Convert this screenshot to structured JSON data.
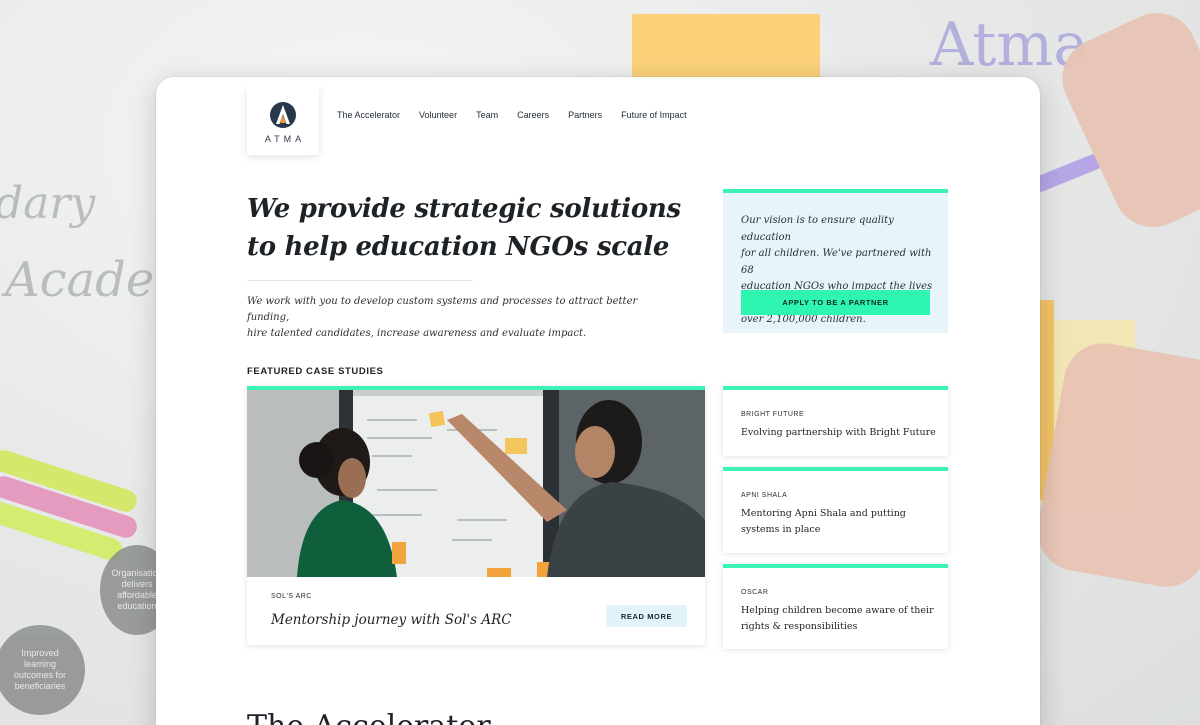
{
  "brand": {
    "name": "ATMA"
  },
  "nav": {
    "items": [
      "The Accelerator",
      "Volunteer",
      "Team",
      "Careers",
      "Partners",
      "Future of Impact"
    ]
  },
  "hero": {
    "title_line1": "We provide strategic solutions",
    "title_line2": "to help education NGOs scale",
    "subtitle_line1": "We work with you to develop custom systems and processes to attract better funding,",
    "subtitle_line2": "hire talented candidates, increase awareness and evaluate impact."
  },
  "vision": {
    "line1": "Our vision is to ensure quality education",
    "line2": "for all children. We've partnered with 68",
    "line3": "education NGOs who impact the lives of",
    "line4": "over 2,100,000 children.",
    "button_label": "APPLY TO BE A PARTNER"
  },
  "case_studies": {
    "section_label": "FEATURED CASE STUDIES",
    "featured": {
      "tag": "SOL'S ARC",
      "title": "Mentorship journey with Sol's ARC",
      "button_label": "READ MORE"
    },
    "side": [
      {
        "tag": "BRIGHT FUTURE",
        "title": "Evolving partnership with Bright Future"
      },
      {
        "tag": "APNI SHALA",
        "title": "Mentoring Apni Shala and putting systems in place"
      },
      {
        "tag": "OSCAR",
        "title": "Helping children become aware of their rights & responsibilities"
      }
    ]
  },
  "next_section": {
    "heading": "The Accelerator"
  },
  "colors": {
    "accent": "#3df2b6",
    "button_green": "#2ef5b0",
    "vision_bg": "#e7f5fb",
    "read_more_bg": "#e3f3fa",
    "text_dark": "#1d2227"
  },
  "background": {
    "scribbles": [
      "dary",
      "Acade",
      "Atma"
    ],
    "circle_labels": [
      "Improved learning outcomes for beneficiaries",
      "Organisation delivers affordable education"
    ]
  }
}
